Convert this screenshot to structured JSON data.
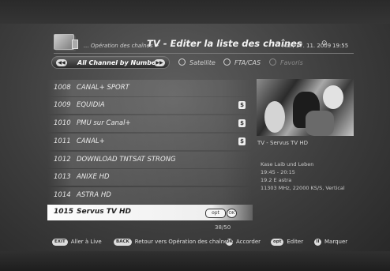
{
  "header": {
    "breadcrumb": "... Opération des chaînes >",
    "title": "TV - Editer la liste des chaînes",
    "date": "Mar, 17. 11. 2009",
    "clock_icon": "⊙",
    "time": "19:55"
  },
  "filter": {
    "left_arrow": "◀◀",
    "label": "All Channel by Number",
    "right_arrow": "▶▶",
    "options": [
      "Satellite",
      "FTA/CAS",
      "Favoris"
    ]
  },
  "channels": [
    {
      "num": "1008",
      "name": "CANAL+ SPORT",
      "badge": ""
    },
    {
      "num": "1009",
      "name": "EQUIDIA",
      "badge": "$"
    },
    {
      "num": "1010",
      "name": "PMU sur Canal+",
      "badge": "$"
    },
    {
      "num": "1011",
      "name": "CANAL+",
      "badge": "$"
    },
    {
      "num": "1012",
      "name": "DOWNLOAD TNTSAT STRONG",
      "badge": ""
    },
    {
      "num": "1013",
      "name": "ANIXE HD",
      "badge": ""
    },
    {
      "num": "1014",
      "name": "ASTRA HD",
      "badge": ""
    },
    {
      "num": "1015",
      "name": "Servus TV HD",
      "badge": ""
    }
  ],
  "selected_row": {
    "opt": "opt",
    "ok": "OK"
  },
  "counter": "38/50",
  "preview": {
    "caption": "TV - Servus TV HD",
    "program": "Kase Laib und Leben",
    "time": "19:45 - 20:15",
    "satellite": "19.2 E astra",
    "transponder": "11303 MHz, 22000 KS/S, Vertical"
  },
  "legend": {
    "exit_key": "EXIT",
    "exit_label": "Aller à Live",
    "back_key": "BACK",
    "back_label": "Retour vers Opération des chaînes",
    "ok_key": "OK",
    "ok_label": "Accorder",
    "opt_key": "opt",
    "opt_label": "Editer",
    "marker_key": "II",
    "marker_label": "Marquer"
  }
}
